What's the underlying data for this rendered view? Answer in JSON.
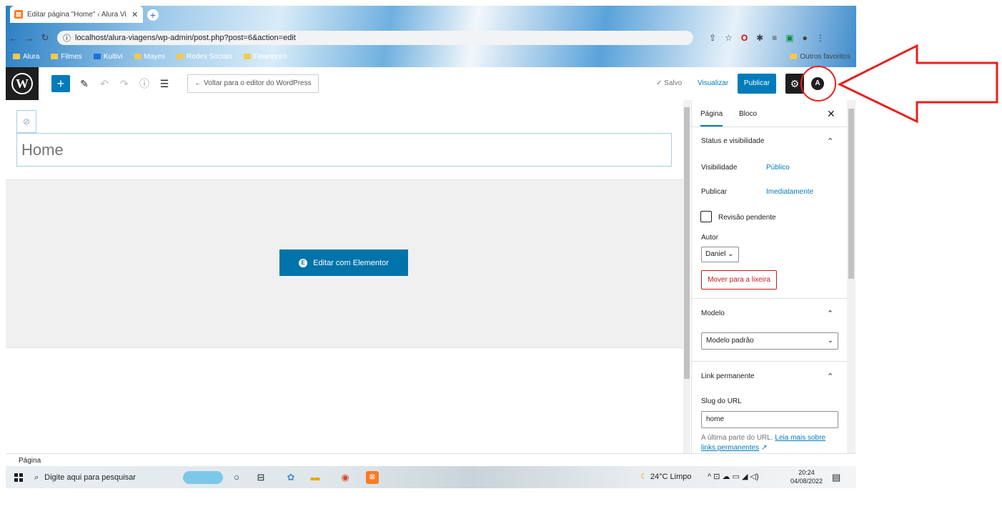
{
  "browser": {
    "tab_title": "Editar página \"Home\" ‹ Alura Vi...",
    "url": "localhost/alura-viagens/wp-admin/post.php?post=6&action=edit",
    "bookmarks": [
      "Alura",
      "Filmes",
      "Kultivi",
      "Mayes",
      "Redes Sociais",
      "Financeiro"
    ],
    "other_bookmarks": "Outros favoritos"
  },
  "toolbar": {
    "back_label": "← Voltar para o editor do WordPress",
    "saved_label": "✓ Salvo",
    "preview_label": "Visualizar",
    "publish_label": "Publicar"
  },
  "editor": {
    "title": "Home",
    "elementor_button": "Editar com Elementor"
  },
  "sidebar": {
    "tab_page": "Página",
    "tab_block": "Bloco",
    "status_title": "Status e visibilidade",
    "visibility_label": "Visibilidade",
    "visibility_value": "Público",
    "publish_label": "Publicar",
    "publish_value": "Imediatamente",
    "pending_label": "Revisão pendente",
    "author_label": "Autor",
    "author_value": "Daniel",
    "trash_button": "Mover para a lixeira",
    "template_title": "Modelo",
    "template_value": "Modelo padrão",
    "permalink_title": "Link permanente",
    "slug_label": "Slug do URL",
    "slug_value": "home",
    "help_text": "A última parte do URL.",
    "help_link": "Leia mais sobre links permanentes"
  },
  "footer": {
    "breadcrumb": "Página"
  },
  "taskbar": {
    "search_placeholder": "Digite aqui para pesquisar",
    "weather": "24°C  Limpo",
    "time": "20:24",
    "date": "04/08/2022"
  },
  "colors": {
    "wp_blue": "#007cba",
    "annotation_red": "#e8201e"
  }
}
